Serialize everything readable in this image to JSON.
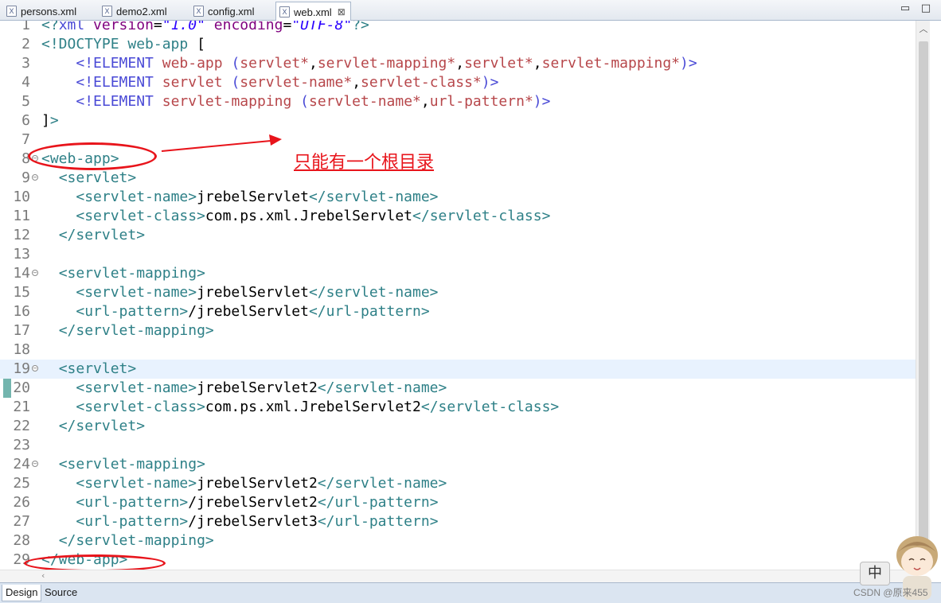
{
  "tabs": [
    {
      "label": "persons.xml",
      "active": false
    },
    {
      "label": "demo2.xml",
      "active": false
    },
    {
      "label": "config.xml",
      "active": false
    },
    {
      "label": "web.xml",
      "active": true
    }
  ],
  "tab_icon_glyph": "X",
  "tab_close_glyph": "⊠",
  "window_controls": {
    "minimize": "▭",
    "maximize": "□"
  },
  "editor": {
    "current_line": 19,
    "lines": [
      {
        "n": "1",
        "fold": false,
        "tokens": [
          [
            "dt",
            "<?"
          ],
          [
            "kw",
            "xml"
          ],
          [
            "txt",
            " "
          ],
          [
            "at",
            "version"
          ],
          [
            "txt",
            "="
          ],
          [
            "str",
            "\"1.0\""
          ],
          [
            "txt",
            " "
          ],
          [
            "at",
            "encoding"
          ],
          [
            "txt",
            "="
          ],
          [
            "str",
            "\"UTF-8\""
          ],
          [
            "dt",
            "?>"
          ]
        ]
      },
      {
        "n": "2",
        "fold": false,
        "tokens": [
          [
            "dt",
            "<!DOCTYPE "
          ],
          [
            "tag",
            "web-app"
          ],
          [
            "txt",
            " ["
          ]
        ]
      },
      {
        "n": "3",
        "fold": false,
        "tokens": [
          [
            "txt",
            "    "
          ],
          [
            "kw",
            "<!ELEMENT"
          ],
          [
            "txt",
            " "
          ],
          [
            "el",
            "web-app"
          ],
          [
            "txt",
            " "
          ],
          [
            "kw",
            "("
          ],
          [
            "el",
            "servlet*"
          ],
          [
            "txt",
            ","
          ],
          [
            "el",
            "servlet-mapping*"
          ],
          [
            "txt",
            ","
          ],
          [
            "el",
            "servlet*"
          ],
          [
            "txt",
            ","
          ],
          [
            "el",
            "servlet-mapping*"
          ],
          [
            "kw",
            ")>"
          ]
        ]
      },
      {
        "n": "4",
        "fold": false,
        "tokens": [
          [
            "txt",
            "    "
          ],
          [
            "kw",
            "<!ELEMENT"
          ],
          [
            "txt",
            " "
          ],
          [
            "el",
            "servlet"
          ],
          [
            "txt",
            " "
          ],
          [
            "kw",
            "("
          ],
          [
            "el",
            "servlet-name*"
          ],
          [
            "txt",
            ","
          ],
          [
            "el",
            "servlet-class*"
          ],
          [
            "kw",
            ")>"
          ]
        ]
      },
      {
        "n": "5",
        "fold": false,
        "tokens": [
          [
            "txt",
            "    "
          ],
          [
            "kw",
            "<!ELEMENT"
          ],
          [
            "txt",
            " "
          ],
          [
            "el",
            "servlet-mapping"
          ],
          [
            "txt",
            " "
          ],
          [
            "kw",
            "("
          ],
          [
            "el",
            "servlet-name*"
          ],
          [
            "txt",
            ","
          ],
          [
            "el",
            "url-pattern*"
          ],
          [
            "kw",
            ")>"
          ]
        ]
      },
      {
        "n": "6",
        "fold": false,
        "tokens": [
          [
            "txt",
            "]"
          ],
          [
            "dt",
            ">"
          ]
        ]
      },
      {
        "n": "7",
        "fold": false,
        "tokens": []
      },
      {
        "n": "8",
        "fold": true,
        "tokens": [
          [
            "tag",
            "<web-app>"
          ]
        ]
      },
      {
        "n": "9",
        "fold": true,
        "tokens": [
          [
            "txt",
            "  "
          ],
          [
            "tag",
            "<servlet>"
          ]
        ]
      },
      {
        "n": "10",
        "fold": false,
        "tokens": [
          [
            "txt",
            "    "
          ],
          [
            "tag",
            "<servlet-name>"
          ],
          [
            "txt",
            "jrebelServlet"
          ],
          [
            "tag",
            "</servlet-name>"
          ]
        ]
      },
      {
        "n": "11",
        "fold": false,
        "tokens": [
          [
            "txt",
            "    "
          ],
          [
            "tag",
            "<servlet-class>"
          ],
          [
            "txt",
            "com.ps.xml.JrebelServlet"
          ],
          [
            "tag",
            "</servlet-class>"
          ]
        ]
      },
      {
        "n": "12",
        "fold": false,
        "tokens": [
          [
            "txt",
            "  "
          ],
          [
            "tag",
            "</servlet>"
          ]
        ]
      },
      {
        "n": "13",
        "fold": false,
        "tokens": []
      },
      {
        "n": "14",
        "fold": true,
        "tokens": [
          [
            "txt",
            "  "
          ],
          [
            "tag",
            "<servlet-mapping>"
          ]
        ]
      },
      {
        "n": "15",
        "fold": false,
        "tokens": [
          [
            "txt",
            "    "
          ],
          [
            "tag",
            "<servlet-name>"
          ],
          [
            "txt",
            "jrebelServlet"
          ],
          [
            "tag",
            "</servlet-name>"
          ]
        ]
      },
      {
        "n": "16",
        "fold": false,
        "tokens": [
          [
            "txt",
            "    "
          ],
          [
            "tag",
            "<url-pattern>"
          ],
          [
            "txt",
            "/jrebelServlet"
          ],
          [
            "tag",
            "</url-pattern>"
          ]
        ]
      },
      {
        "n": "17",
        "fold": false,
        "tokens": [
          [
            "txt",
            "  "
          ],
          [
            "tag",
            "</servlet-mapping>"
          ]
        ]
      },
      {
        "n": "18",
        "fold": false,
        "tokens": []
      },
      {
        "n": "19",
        "fold": true,
        "tokens": [
          [
            "txt",
            "  "
          ],
          [
            "tag",
            "<servlet>"
          ]
        ]
      },
      {
        "n": "20",
        "fold": false,
        "tokens": [
          [
            "txt",
            "    "
          ],
          [
            "tag",
            "<servlet-name>"
          ],
          [
            "txt",
            "jrebelServlet2"
          ],
          [
            "tag",
            "</servlet-name>"
          ]
        ]
      },
      {
        "n": "21",
        "fold": false,
        "tokens": [
          [
            "txt",
            "    "
          ],
          [
            "tag",
            "<servlet-class>"
          ],
          [
            "txt",
            "com.ps.xml.JrebelServlet2"
          ],
          [
            "tag",
            "</servlet-class>"
          ]
        ]
      },
      {
        "n": "22",
        "fold": false,
        "tokens": [
          [
            "txt",
            "  "
          ],
          [
            "tag",
            "</servlet>"
          ]
        ]
      },
      {
        "n": "23",
        "fold": false,
        "tokens": []
      },
      {
        "n": "24",
        "fold": true,
        "tokens": [
          [
            "txt",
            "  "
          ],
          [
            "tag",
            "<servlet-mapping>"
          ]
        ]
      },
      {
        "n": "25",
        "fold": false,
        "tokens": [
          [
            "txt",
            "    "
          ],
          [
            "tag",
            "<servlet-name>"
          ],
          [
            "txt",
            "jrebelServlet2"
          ],
          [
            "tag",
            "</servlet-name>"
          ]
        ]
      },
      {
        "n": "26",
        "fold": false,
        "tokens": [
          [
            "txt",
            "    "
          ],
          [
            "tag",
            "<url-pattern>"
          ],
          [
            "txt",
            "/jrebelServlet2"
          ],
          [
            "tag",
            "</url-pattern>"
          ]
        ]
      },
      {
        "n": "27",
        "fold": false,
        "tokens": [
          [
            "txt",
            "    "
          ],
          [
            "tag",
            "<url-pattern>"
          ],
          [
            "txt",
            "/jrebelServlet3"
          ],
          [
            "tag",
            "</url-pattern>"
          ]
        ]
      },
      {
        "n": "28",
        "fold": false,
        "tokens": [
          [
            "txt",
            "  "
          ],
          [
            "tag",
            "</servlet-mapping>"
          ]
        ]
      },
      {
        "n": "29",
        "fold": false,
        "tokens": [
          [
            "tag",
            "</web-app>"
          ]
        ]
      }
    ]
  },
  "annotation": {
    "text": "只能有一个根目录",
    "color": "#e8141b"
  },
  "bottom_tabs": [
    {
      "label": "Design",
      "active": true
    },
    {
      "label": "Source",
      "active": false
    }
  ],
  "ime_indicator": "中",
  "watermark": "CSDN @原来455",
  "colors": {
    "tag": "#2e8087",
    "keyword": "#4a4ad6",
    "element": "#b7474b",
    "attribute": "#7f007f",
    "string": "#2a00ff",
    "current_line": "#e8f2fe"
  }
}
